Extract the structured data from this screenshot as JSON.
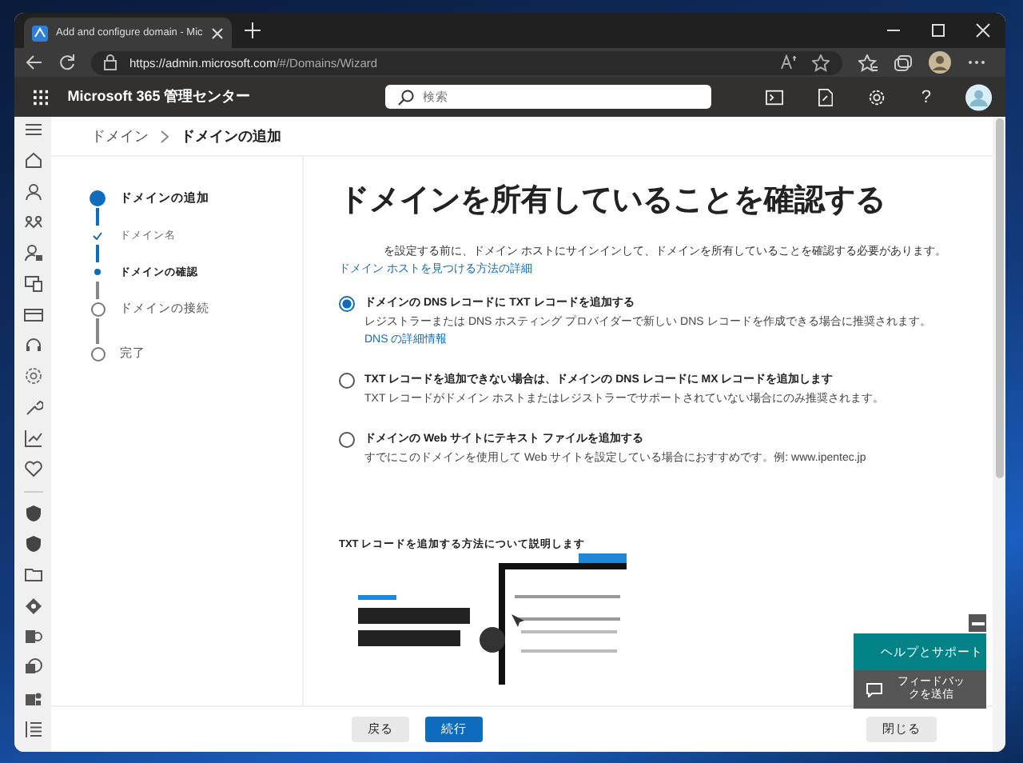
{
  "browser": {
    "tab_title": "Add and configure domain - Mic",
    "url_host": "https://admin.microsoft.com",
    "url_path": "/#/Domains/Wizard"
  },
  "app_header": {
    "title": "Microsoft 365 管理センター",
    "search": {
      "placeholder": "検索"
    },
    "help_label": "?"
  },
  "breadcrumb": [
    "ドメイン",
    "ドメインの追加"
  ],
  "steps": [
    {
      "label": "ドメインの追加",
      "kind": "major",
      "done": false,
      "current": true
    },
    {
      "label": "ドメイン名",
      "kind": "minor",
      "done": true,
      "current": false
    },
    {
      "label": "ドメインの確認",
      "kind": "minor",
      "done": false,
      "current": true
    },
    {
      "label": "ドメインの接続",
      "kind": "major",
      "done": false,
      "current": false
    },
    {
      "label": "完了",
      "kind": "major",
      "done": false,
      "current": false
    }
  ],
  "heading": "ドメインを所有していることを確認する",
  "intro": {
    "text": "を設定する前に、ドメイン ホストにサインインして、ドメインを所有していることを確認する必要があります。",
    "link": "ドメイン ホストを見つける方法の詳細"
  },
  "options": [
    {
      "label": "ドメインの DNS レコードに TXT レコードを追加する",
      "description": "レジストラーまたは DNS ホスティング プロバイダーで新しい DNS レコードを作成できる場合に推奨されます。",
      "link": "DNS の詳細情報",
      "selected": true
    },
    {
      "label": "TXT レコードを追加できない場合は、ドメインの DNS レコードに MX レコードを追加します",
      "description": "TXT レコードがドメイン ホストまたはレジストラーでサポートされていない場合にのみ推奨されます。",
      "selected": false
    },
    {
      "label": "ドメインの Web サイトにテキスト ファイルを追加する",
      "description": "すでにこのドメインを使用して Web サイトを設定している場合におすすめです。例: www.ipentec.jp",
      "selected": false
    }
  ],
  "video": {
    "caption": "TXT レコードを追加する方法について説明します",
    "kind": "picture"
  },
  "footer": {
    "back": "戻る",
    "next": "続行",
    "close": "閉じる"
  },
  "help_widget": {
    "help": "ヘルプとサポート",
    "feedback": "フィードバックを送信"
  }
}
